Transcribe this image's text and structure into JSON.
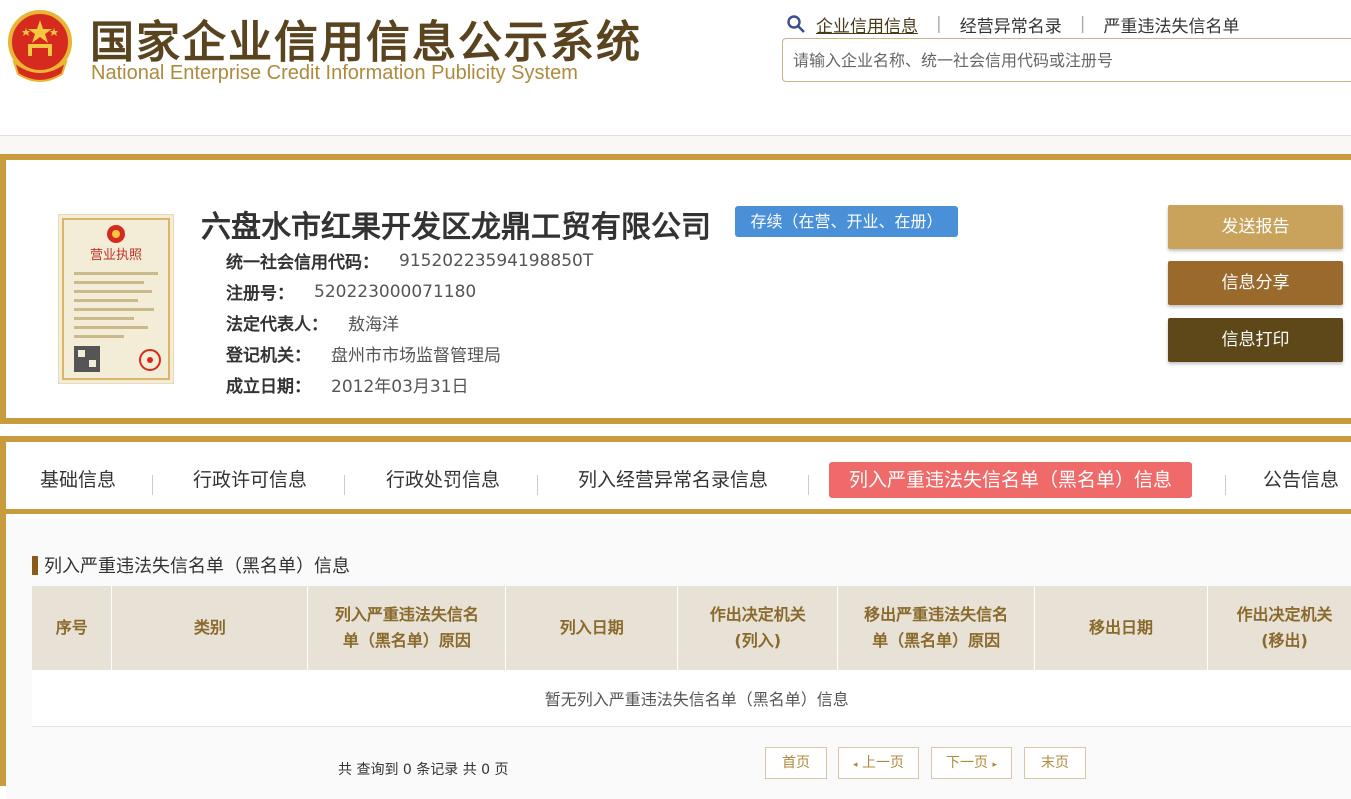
{
  "header": {
    "title_cn": "国家企业信用信息公示系统",
    "title_en": "National Enterprise Credit Information Publicity System",
    "nav": [
      "企业信用信息",
      "经营异常名录",
      "严重违法失信名单"
    ],
    "search_placeholder": "请输入企业名称、统一社会信用代码或注册号"
  },
  "company": {
    "name": "六盘水市红果开发区龙鼎工贸有限公司",
    "status": "存续（在营、开业、在册）",
    "fields": [
      {
        "label": "统一社会信用代码：",
        "value": "91520223594198850T"
      },
      {
        "label": "注册号：",
        "value": "520223000071180"
      },
      {
        "label": "法定代表人：",
        "value": "敖海洋"
      },
      {
        "label": "登记机关：",
        "value": "盘州市市场监督管理局"
      },
      {
        "label": "成立日期：",
        "value": "2012年03月31日"
      }
    ],
    "license_title": "营业执照"
  },
  "actions": {
    "report": "发送报告",
    "share": "信息分享",
    "print": "信息打印"
  },
  "tabs": [
    "基础信息",
    "行政许可信息",
    "行政处罚信息",
    "列入经营异常名录信息",
    "列入严重违法失信名单（黑名单）信息",
    "公告信息"
  ],
  "section": {
    "title": "列入严重违法失信名单（黑名单）信息",
    "columns": [
      [
        "序号"
      ],
      [
        "类别"
      ],
      [
        "列入严重违法失信名",
        "单（黑名单）原因"
      ],
      [
        "列入日期"
      ],
      [
        "作出决定机关",
        "(列入)"
      ],
      [
        "移出严重违法失信名",
        "单（黑名单）原因"
      ],
      [
        "移出日期"
      ],
      [
        "作出决定机关",
        "(移出)"
      ]
    ],
    "empty_text": "暂无列入严重违法失信名单（黑名单）信息"
  },
  "pager": {
    "info": "共 查询到 0 条记录 共 0 页",
    "first": "首页",
    "prev": "上一页",
    "next": "下一页",
    "last": "末页"
  },
  "colors": {
    "gold_border": "#c89b3c",
    "status_blue": "#4a90d9",
    "active_tab": "#f06a6a",
    "report_btn": "#c9a25c",
    "share_btn": "#9a6a2c",
    "print_btn": "#5e4718"
  }
}
